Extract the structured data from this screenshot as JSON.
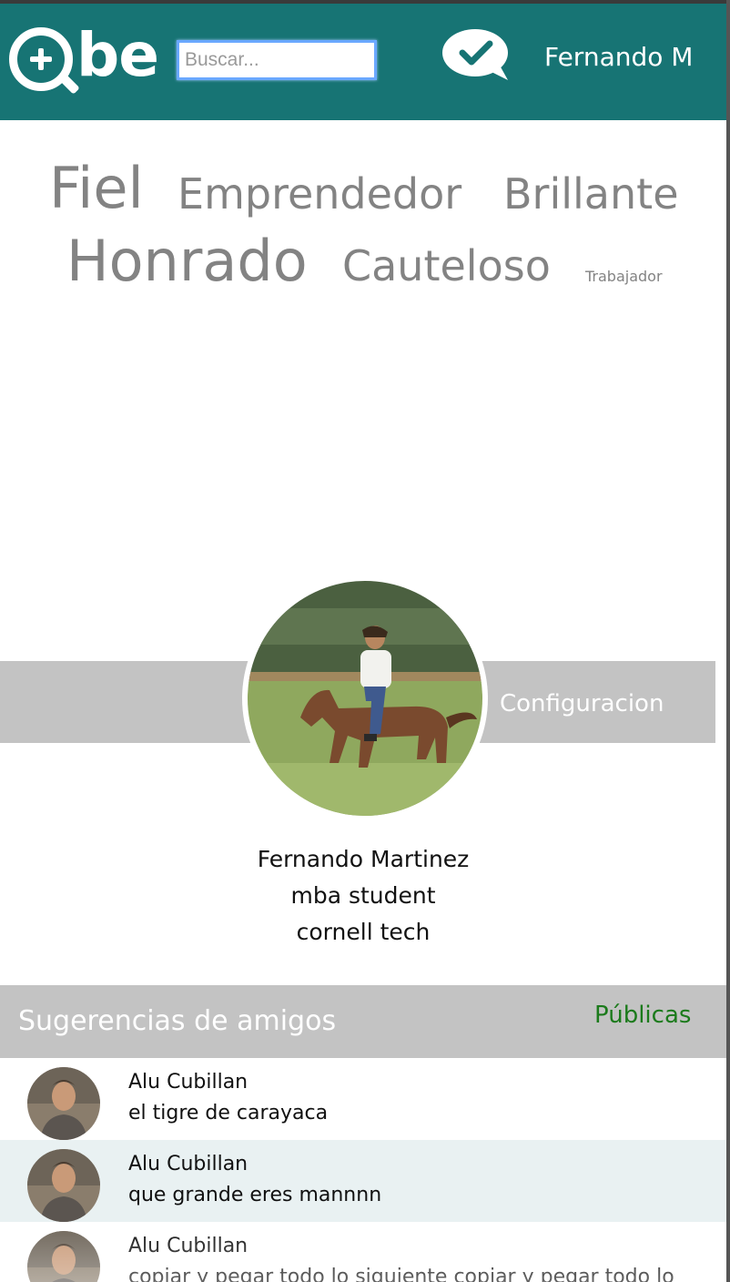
{
  "header": {
    "logo_text": "Qbe",
    "search_placeholder": "Buscar...",
    "user_name": "Fernando M",
    "brand_color": "#177474",
    "chat_icon": "chat-check-icon"
  },
  "traits": [
    "Fiel",
    "Emprendedor",
    "Brillante",
    "Honrado",
    "Cauteloso",
    "Trabajador"
  ],
  "profile": {
    "config_label": "Configuracion",
    "name": "Fernando Martinez",
    "role": "mba student",
    "school": "cornell tech"
  },
  "suggestions": {
    "title": "Sugerencias de amigos",
    "filter_label": "Públicas",
    "items": [
      {
        "name": "Alu Cubillan",
        "message": "el tigre de carayaca"
      },
      {
        "name": "Alu Cubillan",
        "message": "que grande eres mannnn"
      },
      {
        "name": "Alu Cubillan",
        "message": "copiar y pegar todo lo siguiente copiar y pegar todo lo"
      }
    ]
  }
}
